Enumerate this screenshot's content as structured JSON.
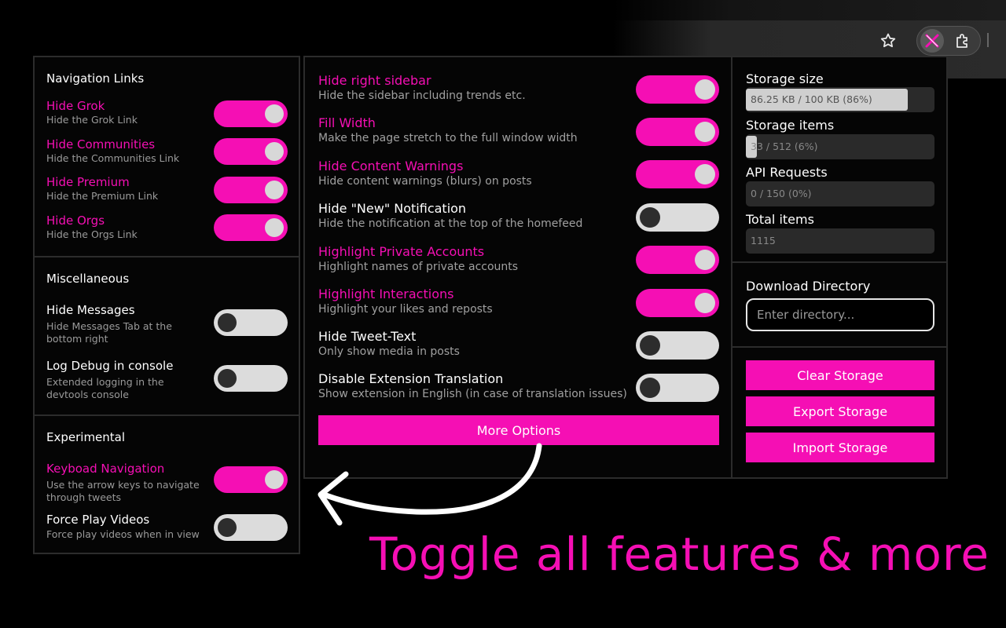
{
  "colors": {
    "accent": "#f50fb4",
    "background": "#000000",
    "panel_border": "#2c2c2c"
  },
  "browser": {
    "icons": [
      "star-icon",
      "x-extension-icon",
      "puzzle-icon"
    ]
  },
  "left": {
    "navigation": {
      "title": "Navigation Links",
      "items": [
        {
          "title": "Hide Grok",
          "desc": "Hide the Grok Link",
          "on": true
        },
        {
          "title": "Hide Communities",
          "desc": "Hide the Communities Link",
          "on": true
        },
        {
          "title": "Hide Premium",
          "desc": "Hide the Premium Link",
          "on": true
        },
        {
          "title": "Hide Orgs",
          "desc": "Hide the Orgs Link",
          "on": true
        }
      ]
    },
    "misc": {
      "title": "Miscellaneous",
      "items": [
        {
          "title": "Hide Messages",
          "desc1": "Hide Messages Tab at the",
          "desc2": "bottom right",
          "on": false
        },
        {
          "title": "Log Debug in console",
          "desc1": "Extended logging in the",
          "desc2": "devtools console",
          "on": false
        }
      ]
    },
    "experimental": {
      "title": "Experimental",
      "items": [
        {
          "title": "Keyboad Navigation",
          "desc1": "Use the arrow keys to navigate",
          "desc2": "through tweets",
          "on": true
        },
        {
          "title": "Force Play Videos",
          "desc1": "Force play videos when in view",
          "on": false
        }
      ]
    }
  },
  "middle": {
    "items": [
      {
        "title": "Hide right sidebar",
        "desc": "Hide the sidebar including trends etc.",
        "on": true
      },
      {
        "title": "Fill Width",
        "desc": "Make the page stretch to the full window width",
        "on": true
      },
      {
        "title": "Hide Content Warnings",
        "desc": "Hide content warnings (blurs) on posts",
        "on": true
      },
      {
        "title": "Hide \"New\" Notification",
        "desc": "Hide the notification at the top of the homefeed",
        "on": false
      },
      {
        "title": "Highlight Private Accounts",
        "desc": "Highlight names of private accounts",
        "on": true
      },
      {
        "title": "Highlight Interactions",
        "desc": "Highlight your likes and reposts",
        "on": true
      },
      {
        "title": "Hide Tweet-Text",
        "desc": "Only show media in posts",
        "on": false
      },
      {
        "title": "Disable Extension Translation",
        "desc": "Show extension in English (in case of translation issues)",
        "on": false
      }
    ],
    "more_options": "More Options"
  },
  "right": {
    "storage_size": {
      "label": "Storage size",
      "value": "86.25 KB / 100 KB (86%)",
      "fraction": 0.86
    },
    "storage_items": {
      "label": "Storage items",
      "value": "33 / 512 (6%)",
      "fraction": 0.06
    },
    "api_requests": {
      "label": "API Requests",
      "value": "0 / 150 (0%)",
      "fraction": 0
    },
    "total_items": {
      "label": "Total items",
      "value": "1115"
    },
    "download_dir": {
      "label": "Download Directory",
      "placeholder": "Enter directory..."
    },
    "buttons": {
      "clear": "Clear Storage",
      "export": "Export Storage",
      "import": "Import Storage"
    }
  },
  "tagline": "Toggle all features & more"
}
